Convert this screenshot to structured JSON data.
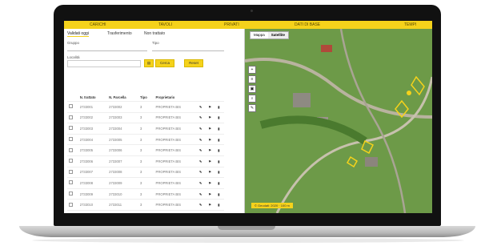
{
  "app": {
    "nav": [
      "CARICHI",
      "TAVOLI",
      "PRIVATI",
      "DATI DI BASE",
      "TEMPI"
    ]
  },
  "left": {
    "tabs": [
      "Validati oggi",
      "Trasferimento",
      "Non trattato"
    ],
    "labels": [
      "Gruppo",
      "Tipo",
      "Località"
    ],
    "buttons": {
      "filter_label": "Cerca",
      "reset_label": "Reset"
    },
    "table": {
      "headers": [
        "",
        "N. trattato",
        "N. Parcella",
        "Tipo",
        "Proprietario",
        "",
        "",
        ""
      ],
      "rows": [
        [
          "",
          "2733001",
          "2733002",
          "3",
          "PROPRIETA BIS",
          "✎",
          "⚑",
          "▮"
        ],
        [
          "",
          "2733002",
          "2733003",
          "3",
          "PROPRIETA BIS",
          "✎",
          "⚑",
          "▮"
        ],
        [
          "",
          "2733003",
          "2733004",
          "3",
          "PROPRIETA BIS",
          "✎",
          "⚑",
          "▮"
        ],
        [
          "",
          "2733004",
          "2733005",
          "3",
          "PROPRIETA BIS",
          "✎",
          "⚑",
          "▮"
        ],
        [
          "",
          "2733005",
          "2733006",
          "3",
          "PROPRIETA BIS",
          "✎",
          "⚑",
          "▮"
        ],
        [
          "",
          "2733006",
          "2733007",
          "3",
          "PROPRIETA BIS",
          "✎",
          "⚑",
          "▮"
        ],
        [
          "",
          "2733007",
          "2733008",
          "3",
          "PROPRIETA BIS",
          "✎",
          "⚑",
          "▮"
        ],
        [
          "",
          "2733008",
          "2733009",
          "3",
          "PROPRIETA BIS",
          "✎",
          "⚑",
          "▮"
        ],
        [
          "",
          "2733009",
          "2733010",
          "3",
          "PROPRIETA BIS",
          "✎",
          "⚑",
          "▮"
        ],
        [
          "",
          "2733010",
          "2733011",
          "3",
          "PROPRIETA BIS",
          "✎",
          "⚑",
          "▮"
        ],
        [
          "",
          "2733011",
          "2733012",
          "3",
          "PROPRIETA BIS",
          "✎",
          "⚑",
          "▮"
        ],
        [
          "",
          "2733012",
          "2733013",
          "3",
          "PROPRIETA BIS",
          "✎",
          "⚑",
          "▮"
        ]
      ]
    }
  },
  "map": {
    "tabs": [
      "Mappa",
      "Satellite"
    ],
    "tools": [
      "plus-icon",
      "layers-icon",
      "print-icon",
      "search-icon",
      "pencil-icon"
    ],
    "scale_text": "© Geodati: 2020 · 100 m"
  }
}
